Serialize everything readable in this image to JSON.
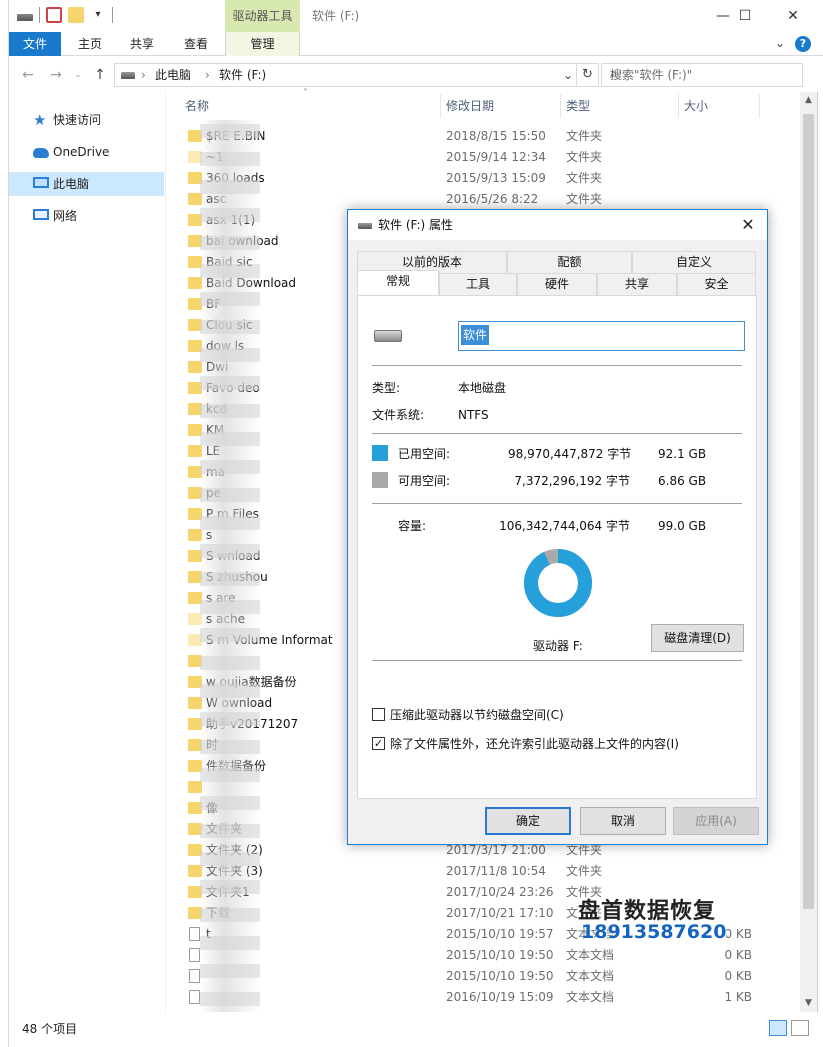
{
  "window": {
    "context_tab": "驱动器工具",
    "title": "软件 (F:)"
  },
  "ribbon": {
    "tabs": [
      "文件",
      "主页",
      "共享",
      "查看",
      "管理"
    ],
    "help": "?"
  },
  "address": {
    "crumbs": [
      "此电脑",
      "软件 (F:)"
    ],
    "search_placeholder": "搜索\"软件 (F:)\""
  },
  "nav": {
    "items": [
      {
        "label": "快速访问",
        "icon": "star-icon"
      },
      {
        "label": "OneDrive",
        "icon": "cloud-icon"
      },
      {
        "label": "此电脑",
        "icon": "computer-icon",
        "selected": true
      },
      {
        "label": "网络",
        "icon": "network-icon"
      }
    ]
  },
  "columns": {
    "name": "名称",
    "date": "修改日期",
    "type": "类型",
    "size": "大小"
  },
  "files": [
    {
      "name": "$RE        E.BIN",
      "date": "2018/8/15 15:50",
      "type": "文件夹",
      "size": "",
      "icon": "folder"
    },
    {
      "name": "~1",
      "date": "2015/9/14 12:34",
      "type": "文件夹",
      "size": "",
      "icon": "folder-light"
    },
    {
      "name": "360        loads",
      "date": "2015/9/13 15:09",
      "type": "文件夹",
      "size": "",
      "icon": "folder"
    },
    {
      "name": "asc",
      "date": "2016/5/26 8:22",
      "type": "文件夹",
      "size": "",
      "icon": "folder"
    },
    {
      "name": "asx        1(1)",
      "date": "",
      "type": "",
      "size": "",
      "icon": "folder"
    },
    {
      "name": "bai        ownload",
      "date": "",
      "type": "",
      "size": "",
      "icon": "folder"
    },
    {
      "name": "Baid       sic",
      "date": "",
      "type": "",
      "size": "",
      "icon": "folder"
    },
    {
      "name": "Baid       Download",
      "date": "",
      "type": "",
      "size": "",
      "icon": "folder"
    },
    {
      "name": "BF",
      "date": "",
      "type": "",
      "size": "",
      "icon": "folder"
    },
    {
      "name": "Clou       sic",
      "date": "",
      "type": "",
      "size": "",
      "icon": "folder"
    },
    {
      "name": "dow        ls",
      "date": "",
      "type": "",
      "size": "",
      "icon": "folder"
    },
    {
      "name": "Dwi",
      "date": "",
      "type": "",
      "size": "",
      "icon": "folder"
    },
    {
      "name": "Favo        deo",
      "date": "",
      "type": "",
      "size": "",
      "icon": "folder"
    },
    {
      "name": "kcd",
      "date": "",
      "type": "",
      "size": "",
      "icon": "folder"
    },
    {
      "name": "KM",
      "date": "",
      "type": "",
      "size": "",
      "icon": "folder"
    },
    {
      "name": "LE",
      "date": "",
      "type": "",
      "size": "",
      "icon": "folder"
    },
    {
      "name": "ma",
      "date": "",
      "type": "",
      "size": "",
      "icon": "folder"
    },
    {
      "name": "pe",
      "date": "",
      "type": "",
      "size": "",
      "icon": "folder"
    },
    {
      "name": "P        m Files",
      "date": "",
      "type": "",
      "size": "",
      "icon": "folder"
    },
    {
      "name": "s",
      "date": "",
      "type": "",
      "size": "",
      "icon": "folder"
    },
    {
      "name": "S        wnload",
      "date": "",
      "type": "",
      "size": "",
      "icon": "folder"
    },
    {
      "name": "S        zhushou",
      "date": "",
      "type": "",
      "size": "",
      "icon": "folder"
    },
    {
      "name": "s        are",
      "date": "",
      "type": "",
      "size": "",
      "icon": "folder"
    },
    {
      "name": "s        ache",
      "date": "",
      "type": "",
      "size": "",
      "icon": "folder-light"
    },
    {
      "name": "S        m Volume Informat",
      "date": "",
      "type": "",
      "size": "",
      "icon": "folder-light"
    },
    {
      "name": "",
      "date": "",
      "type": "",
      "size": "",
      "icon": "folder"
    },
    {
      "name": "w        oujia数据备份",
      "date": "",
      "type": "",
      "size": "",
      "icon": "folder"
    },
    {
      "name": "W        ownload",
      "date": "",
      "type": "",
      "size": "",
      "icon": "folder"
    },
    {
      "name": "        助手v20171207",
      "date": "",
      "type": "",
      "size": "",
      "icon": "folder"
    },
    {
      "name": "        时",
      "date": "",
      "type": "",
      "size": "",
      "icon": "folder"
    },
    {
      "name": "        件数据备份",
      "date": "",
      "type": "",
      "size": "",
      "icon": "folder"
    },
    {
      "name": "",
      "date": "",
      "type": "",
      "size": "",
      "icon": "folder"
    },
    {
      "name": "        像",
      "date": "",
      "type": "",
      "size": "",
      "icon": "folder"
    },
    {
      "name": "        文件夹",
      "date": "",
      "type": "",
      "size": "",
      "icon": "folder"
    },
    {
      "name": "        文件夹 (2)",
      "date": "2017/3/17 21:00",
      "type": "文件夹",
      "size": "",
      "icon": "folder"
    },
    {
      "name": "        文件夹 (3)",
      "date": "2017/11/8 10:54",
      "type": "文件夹",
      "size": "",
      "icon": "folder"
    },
    {
      "name": "        文件夹1",
      "date": "2017/10/24 23:26",
      "type": "文件夹",
      "size": "",
      "icon": "folder"
    },
    {
      "name": "        下载",
      "date": "2017/10/21 17:10",
      "type": "文件夹",
      "size": "",
      "icon": "folder"
    },
    {
      "name": "        t",
      "date": "2015/10/10 19:57",
      "type": "文本文档",
      "size": "0 KB",
      "icon": "doc"
    },
    {
      "name": "",
      "date": "2015/10/10 19:50",
      "type": "文本文档",
      "size": "0 KB",
      "icon": "doc"
    },
    {
      "name": "",
      "date": "2015/10/10 19:50",
      "type": "文本文档",
      "size": "0 KB",
      "icon": "doc"
    },
    {
      "name": "",
      "date": "2016/10/19 15:09",
      "type": "文本文档",
      "size": "1 KB",
      "icon": "doc"
    }
  ],
  "status": {
    "count": "48 个项目"
  },
  "dialog": {
    "title": "软件 (F:) 属性",
    "tabs_row1": [
      "以前的版本",
      "配额",
      "自定义"
    ],
    "tabs_row2": [
      "常规",
      "工具",
      "硬件",
      "共享",
      "安全"
    ],
    "label_value": "软件",
    "type_label": "类型:",
    "type_value": "本地磁盘",
    "fs_label": "文件系统:",
    "fs_value": "NTFS",
    "used_label": "已用空间:",
    "used_bytes": "98,970,447,872 字节",
    "used_gb": "92.1 GB",
    "free_label": "可用空间:",
    "free_bytes": "7,372,296,192 字节",
    "free_gb": "6.86 GB",
    "cap_label": "容量:",
    "cap_bytes": "106,342,744,064 字节",
    "cap_gb": "99.0 GB",
    "drive_label": "驱动器 F:",
    "cleanup": "磁盘清理(D)",
    "compress_label": "压缩此驱动器以节约磁盘空间(C)",
    "compress_checked": false,
    "index_label": "除了文件属性外，还允许索引此驱动器上文件的内容(I)",
    "index_checked": true,
    "ok": "确定",
    "cancel": "取消",
    "apply": "应用(A)",
    "used_fraction": 0.9307,
    "used_color": "#26a0da",
    "free_color": "#a9a9a9"
  },
  "watermark": {
    "line1": "盘首数据恢复",
    "line2": "18913587620"
  }
}
